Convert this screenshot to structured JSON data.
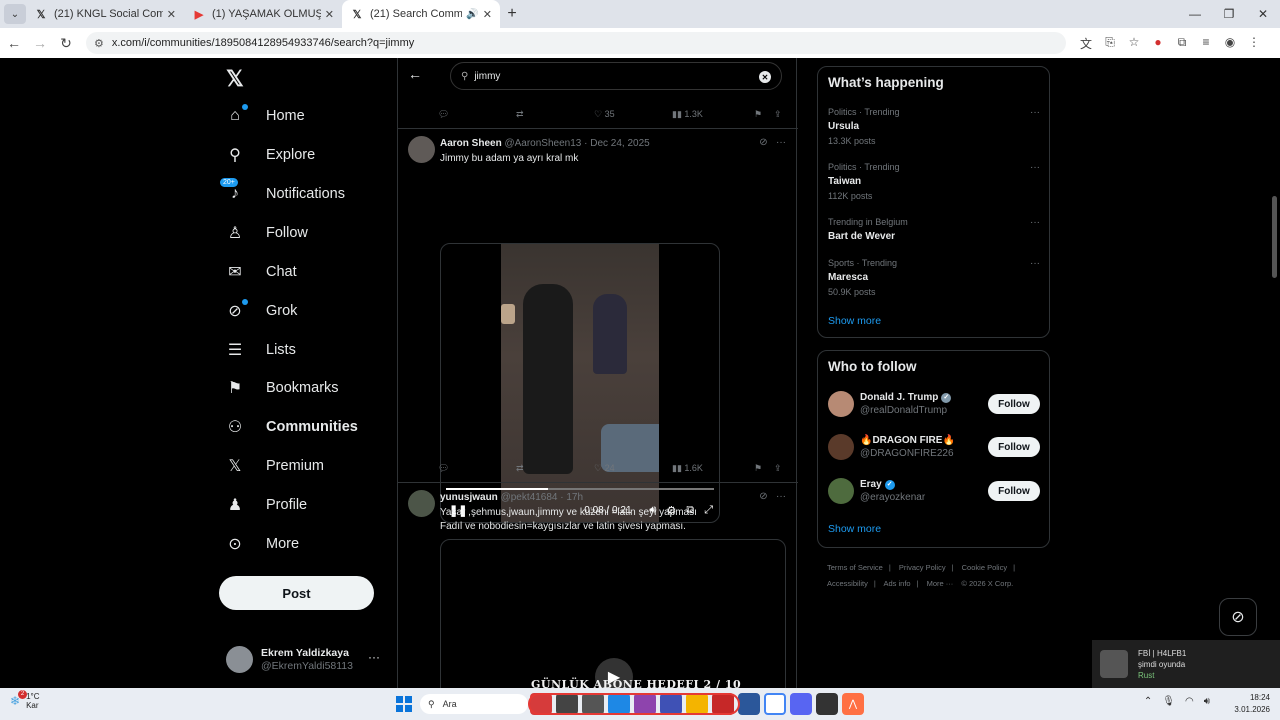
{
  "browser": {
    "tabs": [
      {
        "title": "(21) KNGL Social Community /",
        "favicon": "x-logo-icon",
        "active": false
      },
      {
        "title": "(1) YAŞAMAK OLMUŞ ÖLÜMDE",
        "favicon": "youtube-icon",
        "active": false
      },
      {
        "title": "(21) Search Community / X",
        "favicon": "x-logo-icon",
        "active": true
      }
    ],
    "url": "x.com/i/communities/1895084128954933746/search?q=jimmy"
  },
  "left_nav": {
    "items": [
      {
        "label": "Home",
        "icon": "home-icon"
      },
      {
        "label": "Explore",
        "icon": "search-icon"
      },
      {
        "label": "Notifications",
        "icon": "bell-icon",
        "badge": "20+"
      },
      {
        "label": "Follow",
        "icon": "person-add-icon"
      },
      {
        "label": "Chat",
        "icon": "mail-icon"
      },
      {
        "label": "Grok",
        "icon": "grok-icon"
      },
      {
        "label": "Lists",
        "icon": "list-icon"
      },
      {
        "label": "Bookmarks",
        "icon": "bookmark-icon"
      },
      {
        "label": "Communities",
        "icon": "communities-icon"
      },
      {
        "label": "Premium",
        "icon": "x-logo-icon"
      },
      {
        "label": "Profile",
        "icon": "person-icon"
      },
      {
        "label": "More",
        "icon": "more-circle-icon"
      }
    ],
    "post_button": "Post",
    "account": {
      "name": "Ekrem Yaldizkaya",
      "handle": "@EkremYaldi58113"
    }
  },
  "search": {
    "query": "jimmy"
  },
  "prev_tweet_actions": {
    "replies": "",
    "reposts": "",
    "likes": "35",
    "views": "1.3K"
  },
  "tweets": [
    {
      "name": "Aaron Sheen",
      "handle": "@AaronSheen13",
      "date": "· Dec 24, 2025",
      "text": "Jimmy bu adam ya ayrı kral mk",
      "video": {
        "time": "0:08 / 0:21",
        "progress": 0.381
      },
      "actions": {
        "replies": "",
        "reposts": "",
        "likes": "24",
        "views": "1.6K"
      }
    },
    {
      "name": "yunusjwaun",
      "handle": "@pekt41684",
      "date": "· 17h",
      "text_line1": "Yaşar ,şehmus,jwaun,jimmy ve kuzeni =latin şeyi yapması",
      "text_line2": "Fadıl ve nobodiesin=kaygısızlar ve latin şivesi yapması.",
      "video_caption": "GÜNLÜK ABONE HEDEFI    2  / 10"
    }
  ],
  "whats_happening": {
    "title": "What’s happening",
    "trends": [
      {
        "context": "Politics · Trending",
        "name": "Ursula",
        "posts": "13.3K posts"
      },
      {
        "context": "Politics · Trending",
        "name": "Taiwan",
        "posts": "112K posts"
      },
      {
        "context": "Trending in Belgium",
        "name": "Bart de Wever",
        "posts": ""
      },
      {
        "context": "Sports · Trending",
        "name": "Maresca",
        "posts": "50.9K posts"
      }
    ],
    "show_more": "Show more"
  },
  "who_to_follow": {
    "title": "Who to follow",
    "accounts": [
      {
        "name": "Donald J. Trump",
        "handle": "@realDonaldTrump",
        "verified_color": "#829aab",
        "button": "Follow"
      },
      {
        "name": "🔥DRAGON FIRE🔥",
        "handle": "@DRAGONFIRE226",
        "verified_color": "",
        "button": "Follow"
      },
      {
        "name": "Eray",
        "handle": "@erayozkenar",
        "verified_color": "#1d9bf0",
        "button": "Follow"
      }
    ],
    "show_more": "Show more"
  },
  "footer": {
    "links": [
      "Terms of Service",
      "|",
      "Privacy Policy",
      "|",
      "Cookie Policy",
      "|",
      "Accessibility",
      "|",
      "Ads info",
      "|",
      "More ···",
      "© 2026 X Corp."
    ]
  },
  "notification_toast": {
    "title": "FBİ | H4LFB1",
    "line2": "şimdi oyunda",
    "line3": "Rust"
  },
  "taskbar": {
    "weather_temp": "1°C",
    "weather_desc": "Kar",
    "weather_badge": "2",
    "search_label": "Ara",
    "time": "18:24",
    "date": "3.01.2026"
  },
  "colors": {
    "accent": "#1d9bf0",
    "background": "#000000",
    "border": "#2f3336",
    "muted": "#71767b"
  }
}
